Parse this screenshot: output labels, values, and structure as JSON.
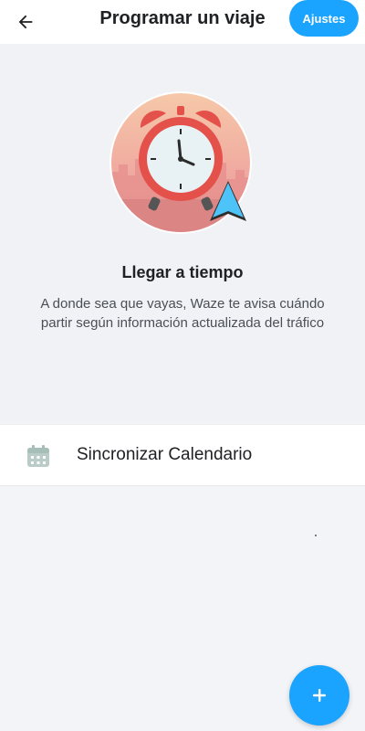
{
  "header": {
    "title": "Programar un viaje",
    "settings_label": "Ajustes",
    "back_icon": "arrow-back-icon"
  },
  "hero": {
    "illustration": "alarm-clock-illustration",
    "title": "Llegar a tiempo",
    "description": "A donde sea que vayas, Waze te avisa  cuándo partir según información actualizada del tráfico"
  },
  "calendar": {
    "label": "Sincronizar Calendario",
    "icon": "calendar-icon"
  },
  "fab": {
    "label": "+",
    "icon": "plus-icon"
  },
  "colors": {
    "accent": "#1aa3ff",
    "background": "#f3f4f7",
    "card": "#ffffff",
    "text": "#202124"
  }
}
